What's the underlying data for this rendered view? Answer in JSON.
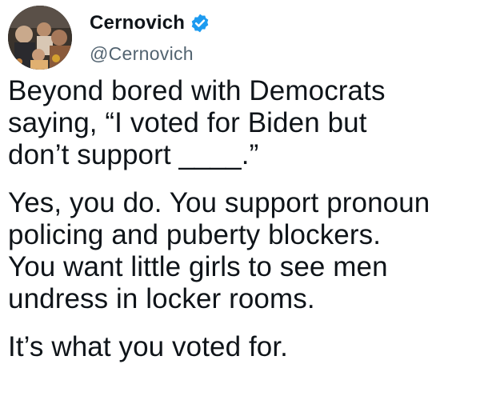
{
  "tweet": {
    "display_name": "Cernovich",
    "handle": "@Cernovich",
    "verified_icon": "verified-badge-icon",
    "accent_color": "#1d9bf0",
    "paragraphs": [
      {
        "lines": [
          "Beyond bored with Democrats",
          "saying, “I voted for Biden but",
          "don’t support ____.”"
        ]
      },
      {
        "lines": [
          "Yes, you do. You support pronoun",
          "policing and puberty blockers.",
          "You want little girls to see men",
          "undress in locker rooms."
        ]
      },
      {
        "lines": [
          "It’s what you voted for."
        ]
      }
    ]
  }
}
